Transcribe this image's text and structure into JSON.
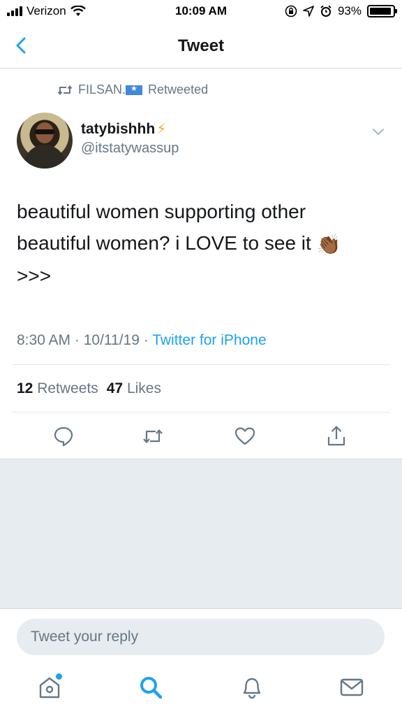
{
  "status_bar": {
    "carrier": "Verizon",
    "time": "10:09 AM",
    "battery": "93%",
    "battery_level": 0.93
  },
  "nav": {
    "title": "Tweet"
  },
  "retweet": {
    "by": "FILSAN.",
    "label": "Retweeted"
  },
  "tweet": {
    "display_name": "tatybishhh",
    "handle": "@itstatywassup",
    "text_line1": "beautiful women supporting other",
    "text_line2": "beautiful women? i LOVE to see it",
    "emoji": "👏🏾",
    "text_line3": ">>>",
    "time": "8:30 AM",
    "sep1": " · ",
    "date": "10/11/19",
    "sep2": " · ",
    "source": "Twitter for iPhone"
  },
  "stats": {
    "retweets_count": "12",
    "retweets_label": "Retweets",
    "likes_count": "47",
    "likes_label": "Likes"
  },
  "reply": {
    "placeholder": "Tweet your reply"
  },
  "icons": {
    "back": "chevron-left-icon",
    "caret": "chevron-down-icon",
    "reply": "reply-icon",
    "retweet": "retweet-icon",
    "like": "heart-icon",
    "share": "share-icon",
    "home": "home-icon",
    "search": "search-icon",
    "notifications": "bell-icon",
    "messages": "mail-icon"
  },
  "colors": {
    "accent": "#1da1f2",
    "secondary_text": "#657786",
    "background_gray": "#e6ecf0"
  }
}
